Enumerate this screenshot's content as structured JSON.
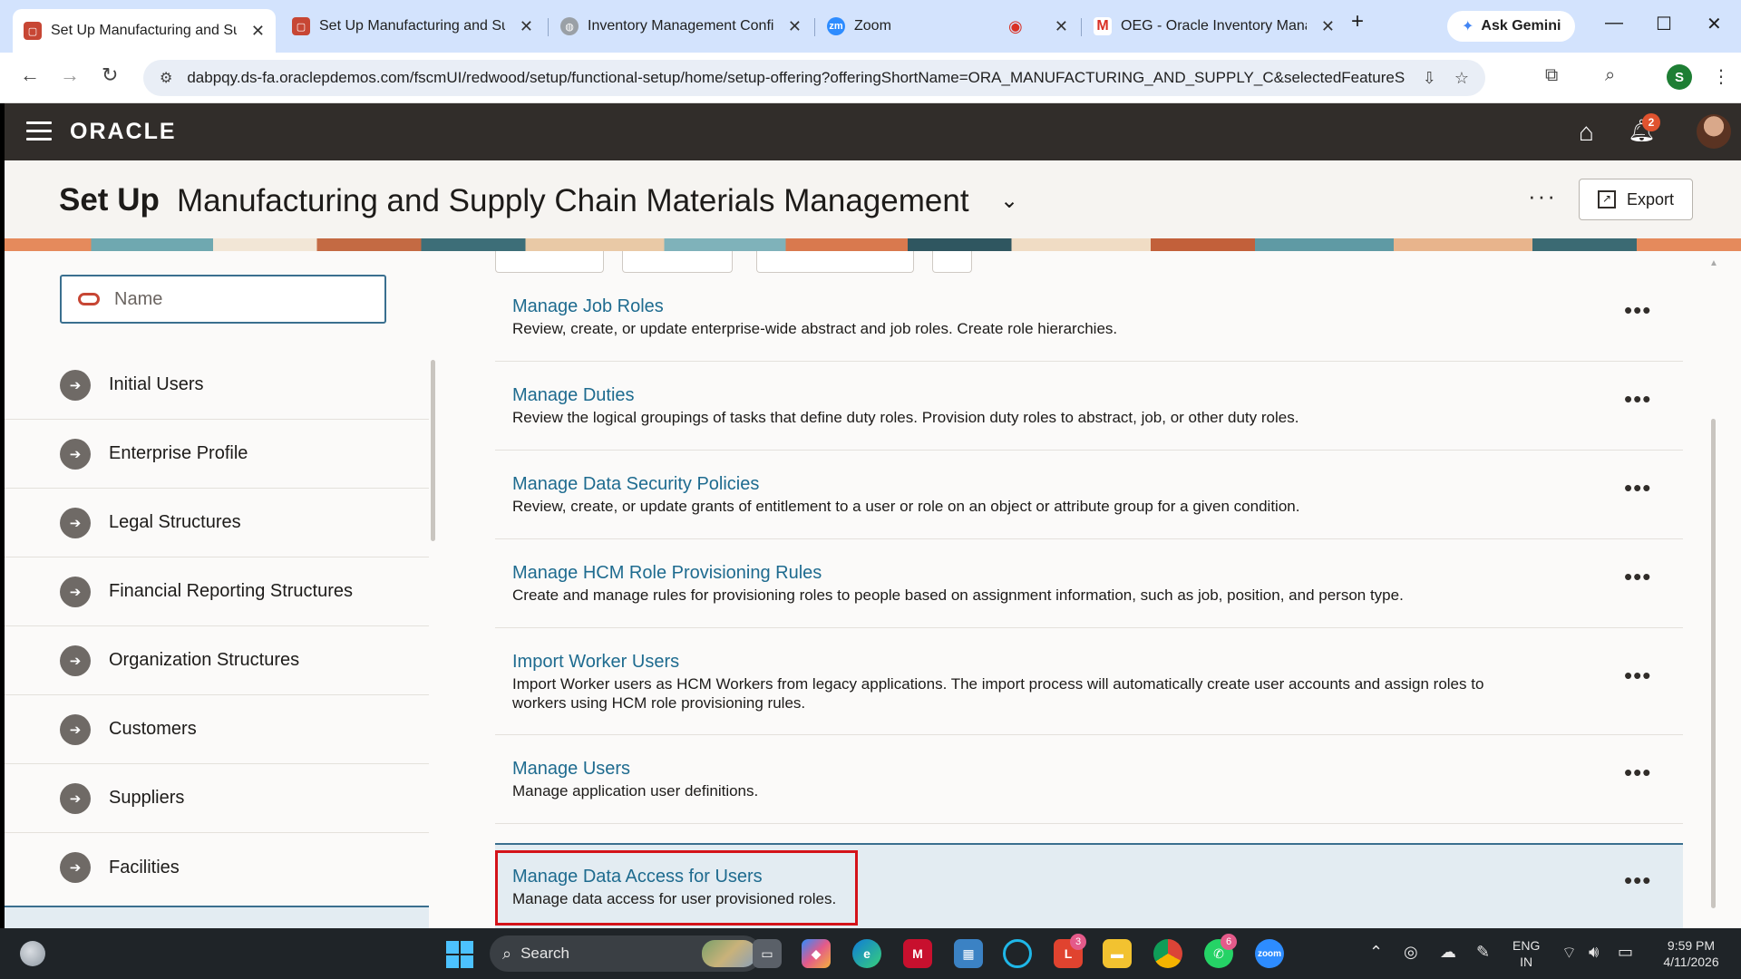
{
  "browser": {
    "tabs": [
      {
        "title": "Set Up Manufacturing and Sup",
        "active": true,
        "favicon": "oracle-icon"
      },
      {
        "title": "Set Up Manufacturing and Sup",
        "active": false,
        "favicon": "oracle-icon"
      },
      {
        "title": "Inventory Management Config",
        "active": false,
        "favicon": "globe-icon"
      },
      {
        "title": "Zoom",
        "active": false,
        "favicon": "zoom-icon"
      },
      {
        "title": "OEG - Oracle Inventory Manag",
        "active": false,
        "favicon": "gmail-icon"
      }
    ],
    "new_tab": "+",
    "gemini_label": "Ask Gemini",
    "url": "dabpqy.ds-fa.oraclepdemos.com/fscmUI/redwood/setup/functional-setup/home/setup-offering?offeringShortName=ORA_MANUFACTURING_AND_SUPPLY_C&selectedFeatureS...",
    "profile_initial": "S"
  },
  "app": {
    "logo": "ORACLE",
    "notification_count": "2",
    "title_prefix": "Set Up",
    "offering_name": "Manufacturing and Supply Chain Materials Management",
    "more_label": "···",
    "export_label": "Export"
  },
  "search": {
    "placeholder": "Name",
    "value": ""
  },
  "functional_areas": [
    "Initial Users",
    "Enterprise Profile",
    "Legal Structures",
    "Financial Reporting Structures",
    "Organization Structures",
    "Customers",
    "Suppliers",
    "Facilities"
  ],
  "tasks": [
    {
      "name": "Manage Job Roles",
      "description": "Review, create, or update enterprise-wide abstract and job roles. Create role hierarchies."
    },
    {
      "name": "Manage Duties",
      "description": "Review the logical groupings of tasks that define duty roles. Provision duty roles to abstract, job, or other duty roles."
    },
    {
      "name": "Manage Data Security Policies",
      "description": "Review, create, or update grants of entitlement to a user or role on an object or attribute group for a given condition."
    },
    {
      "name": "Manage HCM Role Provisioning Rules",
      "description": "Create and manage rules for provisioning roles to people based on assignment information, such as job, position, and person type."
    },
    {
      "name": "Import Worker Users",
      "description": "Import Worker users as HCM Workers from legacy applications. The import process will automatically create user accounts and assign roles to workers using HCM role provisioning rules."
    },
    {
      "name": "Manage Users",
      "description": "Manage application user definitions."
    },
    {
      "name": "Manage Data Access for Users",
      "description": "Manage data access for user provisioned roles.",
      "selected": true
    }
  ],
  "taskbar": {
    "search_label": "Search",
    "badges": {
      "app_l": "3",
      "whatsapp": "6"
    },
    "language": "ENG",
    "region": "IN",
    "time": "9:59 PM",
    "date": "4/11/2026"
  },
  "colors": {
    "oracle_header": "#312d2a",
    "link": "#1e6b8f",
    "highlight_box": "#d4131a",
    "selected_row": "#e3ecf2"
  }
}
